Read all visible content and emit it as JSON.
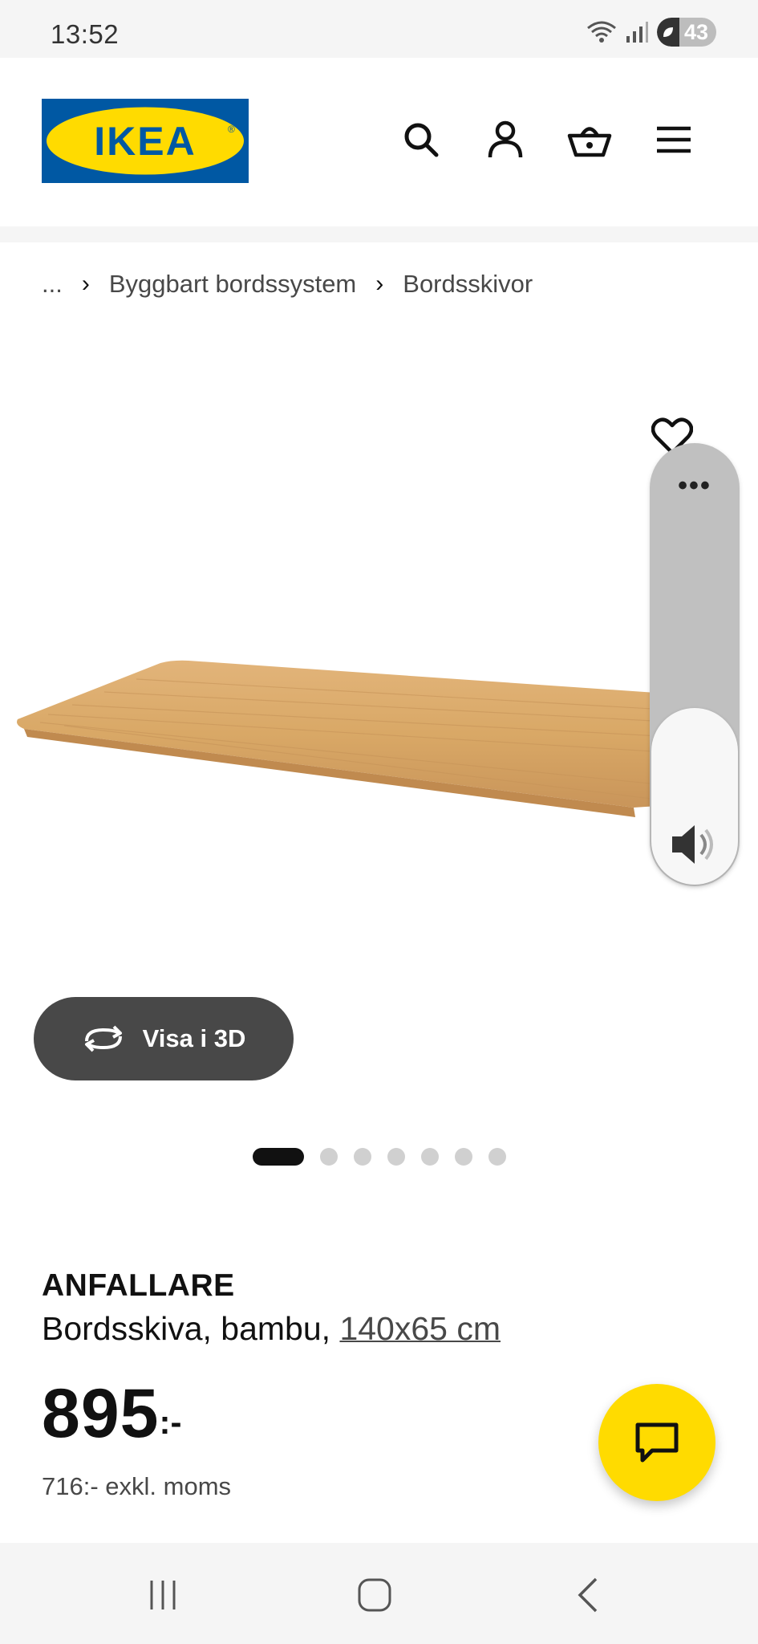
{
  "status_bar": {
    "time": "13:52",
    "battery_level": "43",
    "icons": [
      "wifi-icon",
      "signal-icon",
      "battery-icon"
    ]
  },
  "header": {
    "logo_text": "IKEA",
    "icons": [
      "search-icon",
      "account-icon",
      "cart-icon",
      "menu-icon"
    ]
  },
  "breadcrumb": {
    "items": [
      "...",
      "Byggbart bordssystem",
      "Bordsskivor"
    ]
  },
  "product": {
    "name": "ANFALLARE",
    "description_prefix": "Bordsskiva, bambu, ",
    "size_link": "140x65 cm",
    "price_main": "895",
    "price_suffix": ":-",
    "price_excl_vat": "716:- exkl. moms"
  },
  "gallery": {
    "view_3d_label": "Visa i 3D",
    "image_count": 7,
    "active_index": 0
  },
  "side_panel": {
    "more_label": "•••"
  },
  "colors": {
    "ikea_blue": "#0058a3",
    "ikea_yellow": "#ffdb00",
    "dark_button": "#484848"
  }
}
